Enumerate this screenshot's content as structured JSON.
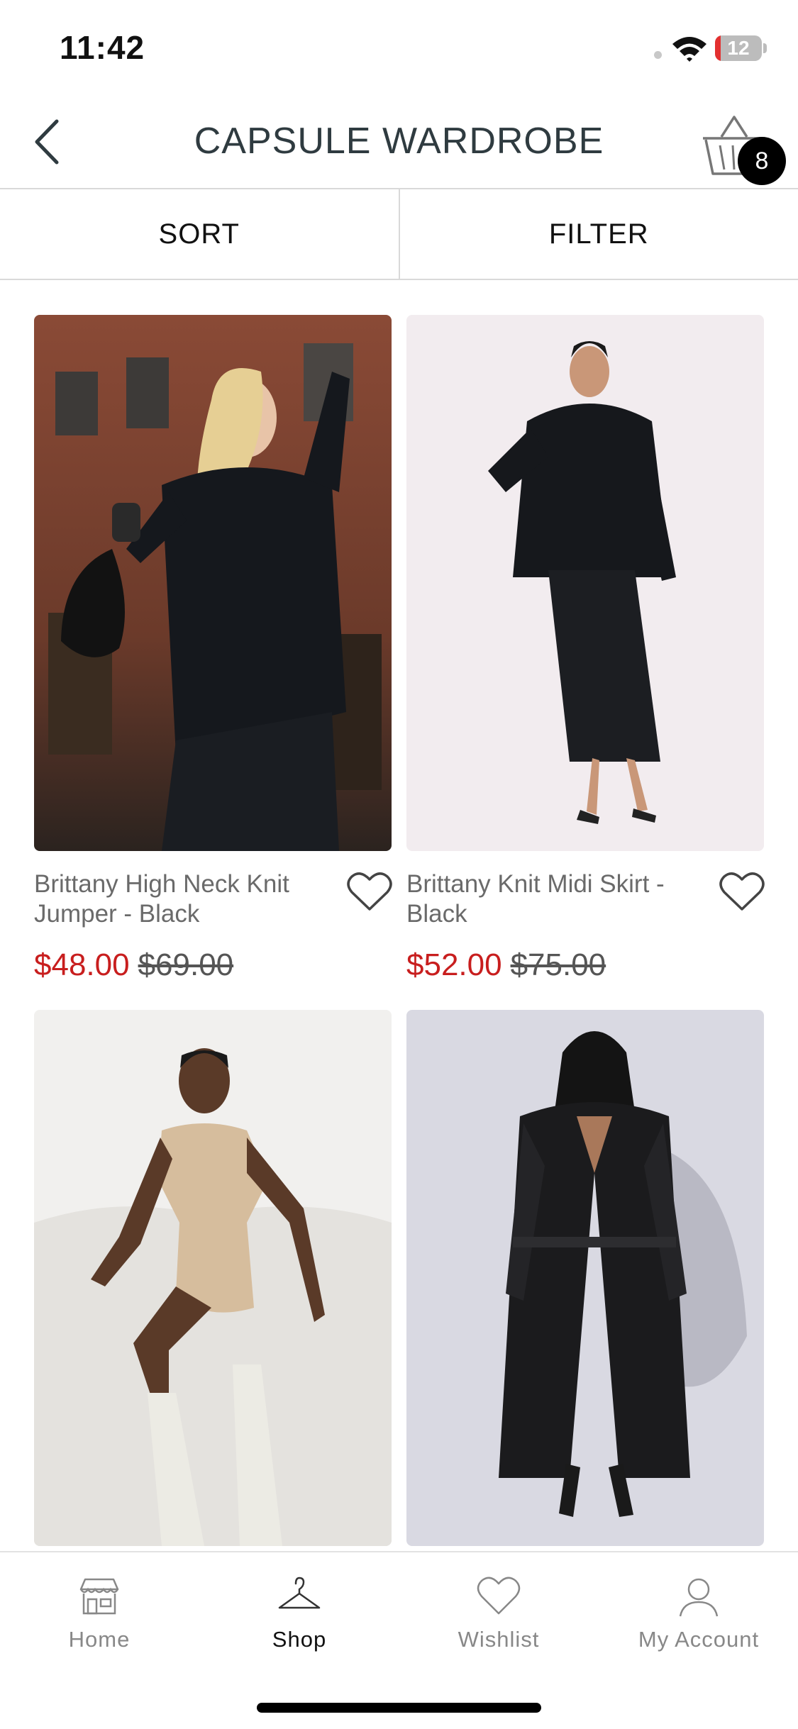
{
  "status_bar": {
    "time": "11:42",
    "battery_level": "12",
    "battery_fraction": 0.12
  },
  "header": {
    "title": "CAPSULE WARDROBE",
    "cart_count": "8"
  },
  "toolbar": {
    "sort_label": "SORT",
    "filter_label": "FILTER"
  },
  "products": [
    {
      "name": "Brittany High Neck Knit Jumper - Black",
      "sale_price": "$48.00",
      "original_price": "$69.00"
    },
    {
      "name": "Brittany Knit Midi Skirt - Black",
      "sale_price": "$52.00",
      "original_price": "$75.00"
    },
    {},
    {}
  ],
  "tab_bar": {
    "tabs": [
      {
        "label": "Home",
        "icon": "storefront-icon"
      },
      {
        "label": "Shop",
        "icon": "hanger-icon",
        "active": true
      },
      {
        "label": "Wishlist",
        "icon": "heart-icon"
      },
      {
        "label": "My Account",
        "icon": "user-icon"
      }
    ]
  },
  "colors": {
    "sale_price": "#c81e1e",
    "cart_badge": "#000000",
    "battery_low": "#e33030"
  }
}
